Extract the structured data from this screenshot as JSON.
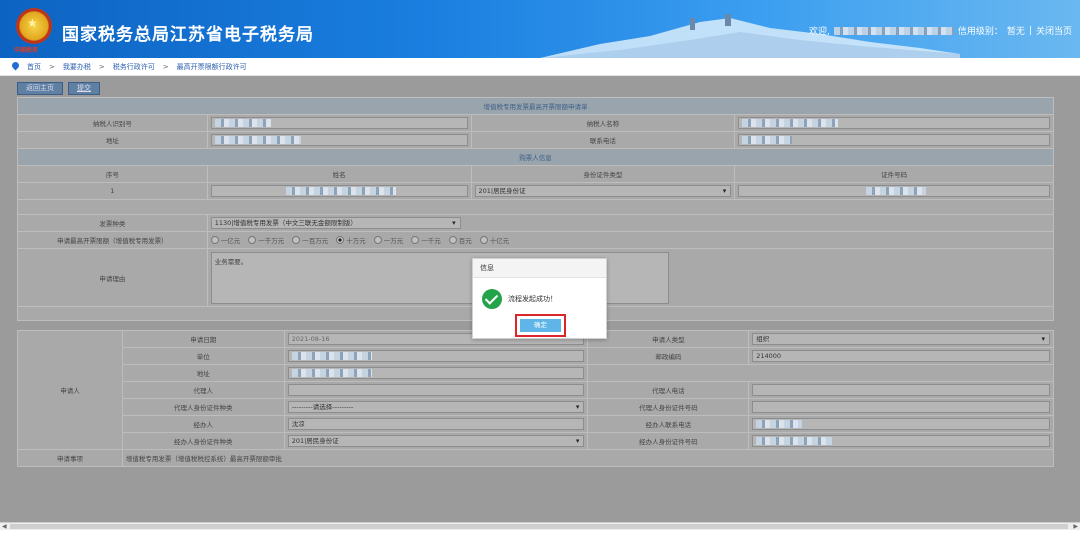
{
  "header": {
    "title": "国家税务总局江苏省电子税务局",
    "emblem_tag": "中国税务",
    "welcome": "欢迎,",
    "credit_label": "信用级别：",
    "credit_value": "暂无",
    "divider": "|",
    "close_page": "关闭当页"
  },
  "breadcrumb": {
    "items": [
      "首页",
      "我要办税",
      "税务行政许可",
      "最高开票限额行政许可"
    ],
    "sep": ">"
  },
  "toolbar": {
    "home": "返回主页",
    "submit": "提交"
  },
  "form": {
    "title": "增值税专用发票最高开票限额申请单",
    "taxpayer_id_label": "纳税人识别号",
    "taxpayer_name_label": "纳税人名称",
    "address_label": "地址",
    "phone_label": "联系电话",
    "buyer_section": "购票人信息",
    "buyer_headers": [
      "序号",
      "姓名",
      "身份证件类型",
      "证件号码"
    ],
    "buyer_row": {
      "index": "1",
      "id_type": "201|居民身份证"
    },
    "invoice_type_label": "发票种类",
    "invoice_type_value": "1130|增值税专用发票（中文三联无金额限制版）",
    "limit_label": "申请最高开票限额（增值税专用发票）",
    "limit_options": [
      "一亿元",
      "一千万元",
      "一百万元",
      "十万元",
      "一万元",
      "一千元",
      "百元",
      "十亿元"
    ],
    "limit_selected": "十万元",
    "reason_label": "申请理由",
    "reason_value": "业务需要。"
  },
  "applicant": {
    "group_label": "申请人",
    "date_label": "申请日期",
    "date_value": "2021-08-16",
    "type_label": "申请人类型",
    "type_value": "组织",
    "unit_label": "单位",
    "postcode_label": "邮政编码",
    "postcode_value": "214000",
    "address_label": "地址",
    "agent_label": "代理人",
    "agent_phone_label": "代理人电话",
    "agent_id_type_label": "代理人身份证件种类",
    "agent_id_type_value": "---------请选择---------",
    "agent_id_no_label": "代理人身份证件号码",
    "handler_label": "经办人",
    "handler_value": "沈凉",
    "handler_phone_label": "经办人联系电话",
    "handler_id_type_label": "经办人身份证件种类",
    "handler_id_type_value": "201|居民身份证",
    "handler_id_no_label": "经办人身份证件号码",
    "matter_label": "申请事项",
    "matter_value": "增值税专用发票（增值税税控系统）最高开票限额审批"
  },
  "dialog": {
    "title": "信息",
    "message": "流程发起成功！",
    "ok": "确定"
  }
}
